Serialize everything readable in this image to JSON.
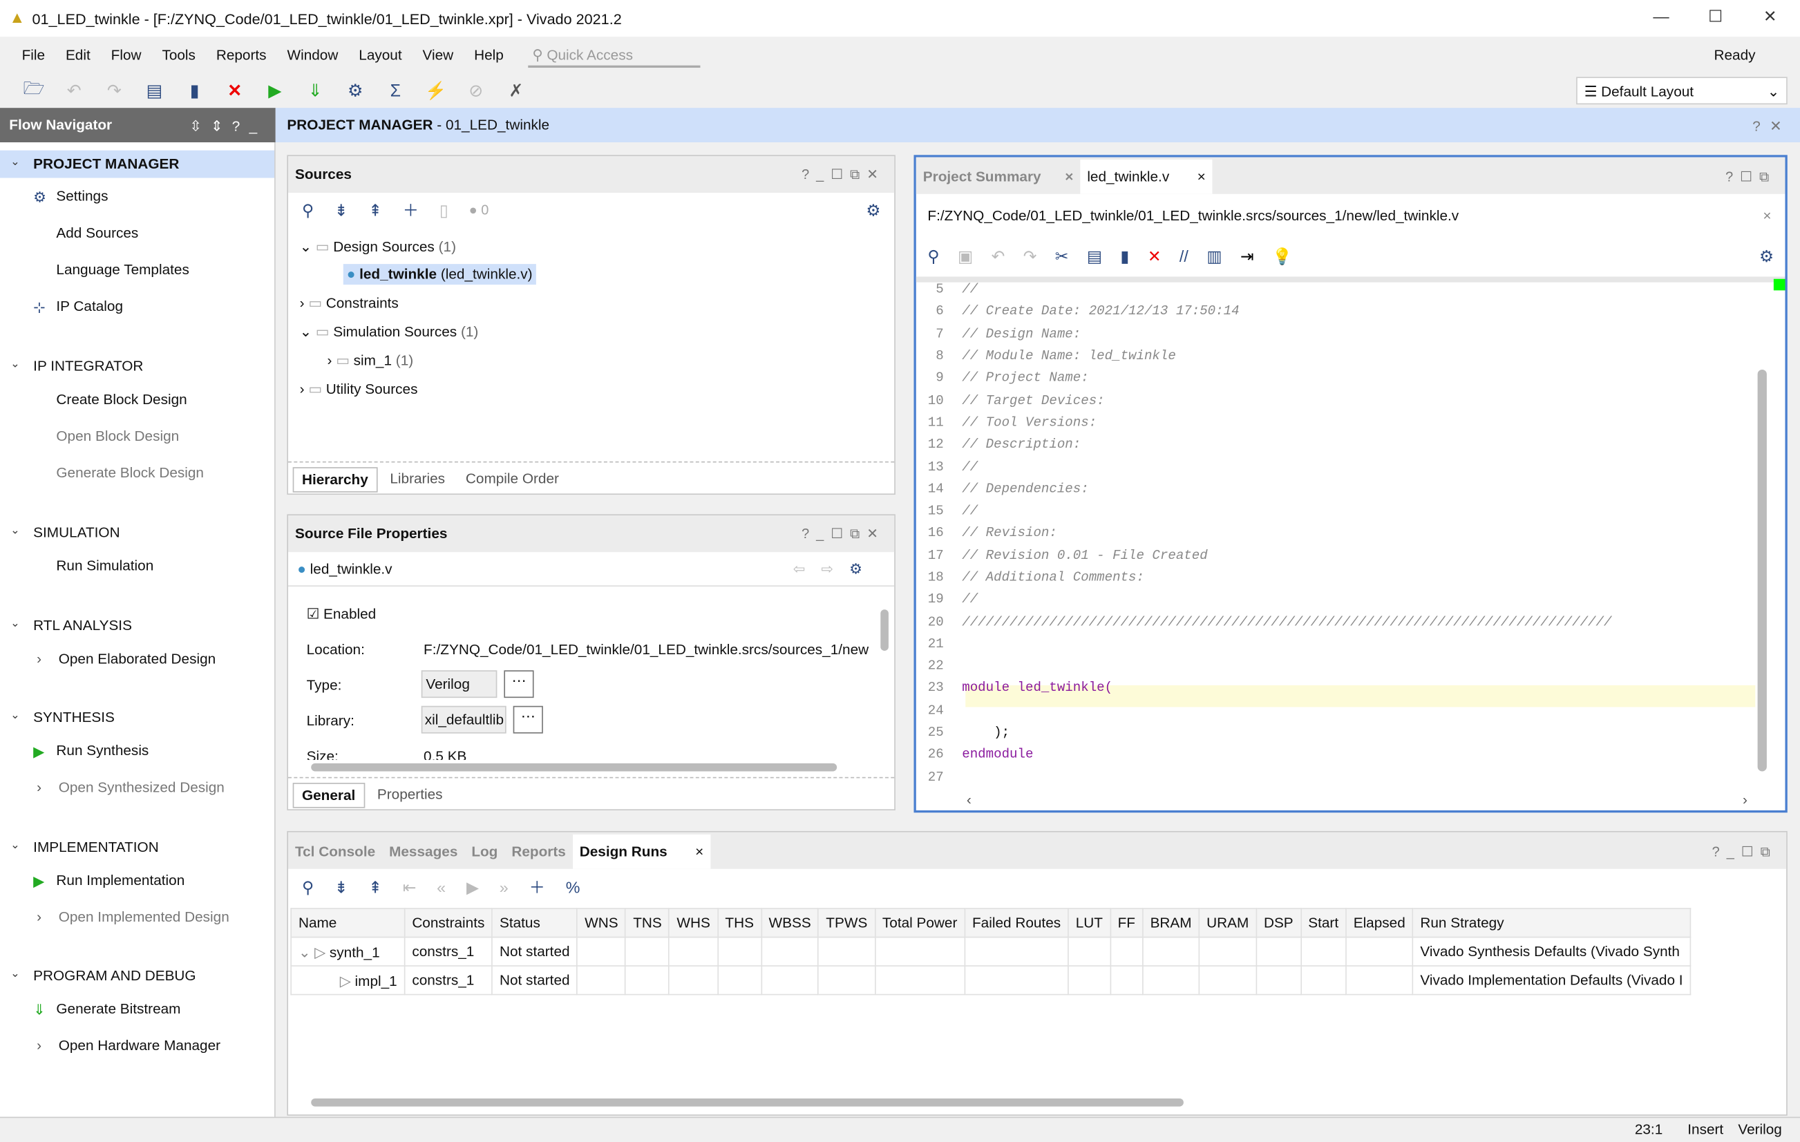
{
  "window": {
    "title": "01_LED_twinkle - [F:/ZYNQ_Code/01_LED_twinkle/01_LED_twinkle.xpr] - Vivado 2021.2",
    "status": "Ready"
  },
  "menu": [
    "File",
    "Edit",
    "Flow",
    "Tools",
    "Reports",
    "Window",
    "Layout",
    "View",
    "Help"
  ],
  "quick_access": {
    "placeholder": "Quick Access"
  },
  "layout_select": "Default Layout",
  "flow_navigator": {
    "title": "Flow Navigator",
    "sections": [
      {
        "label": "PROJECT MANAGER",
        "items": [
          "Settings",
          "Add Sources",
          "Language Templates",
          "IP Catalog"
        ]
      },
      {
        "label": "IP INTEGRATOR",
        "items": [
          "Create Block Design",
          "Open Block Design",
          "Generate Block Design"
        ]
      },
      {
        "label": "SIMULATION",
        "items": [
          "Run Simulation"
        ]
      },
      {
        "label": "RTL ANALYSIS",
        "items": [
          "Open Elaborated Design"
        ]
      },
      {
        "label": "SYNTHESIS",
        "items": [
          "Run Synthesis",
          "Open Synthesized Design"
        ]
      },
      {
        "label": "IMPLEMENTATION",
        "items": [
          "Run Implementation",
          "Open Implemented Design"
        ]
      },
      {
        "label": "PROGRAM AND DEBUG",
        "items": [
          "Generate Bitstream",
          "Open Hardware Manager"
        ]
      }
    ]
  },
  "header": {
    "bold": "PROJECT MANAGER",
    "rest": " - 01_LED_twinkle"
  },
  "sources": {
    "title": "Sources",
    "count": "0",
    "tree": {
      "design": "Design Sources",
      "design_count": "(1)",
      "top": "led_twinkle",
      "top_file": "(led_twinkle.v)",
      "constraints": "Constraints",
      "sim": "Simulation Sources",
      "sim_count": "(1)",
      "sim1": "sim_1",
      "sim1_count": "(1)",
      "utility": "Utility Sources"
    },
    "tabs": [
      "Hierarchy",
      "Libraries",
      "Compile Order"
    ]
  },
  "props": {
    "title": "Source File Properties",
    "file": "led_twinkle.v",
    "enabled": "Enabled",
    "location_label": "Location:",
    "location": "F:/ZYNQ_Code/01_LED_twinkle/01_LED_twinkle.srcs/sources_1/new",
    "type_label": "Type:",
    "type": "Verilog",
    "library_label": "Library:",
    "library": "xil_defaultlib",
    "size_label": "Size:",
    "size": "0.5 KB",
    "tabs": [
      "General",
      "Properties"
    ]
  },
  "editor": {
    "tabs": [
      "Project Summary",
      "led_twinkle.v"
    ],
    "path": "F:/ZYNQ_Code/01_LED_twinkle/01_LED_twinkle.srcs/sources_1/new/led_twinkle.v",
    "lines": [
      {
        "n": "5",
        "t": "//",
        "c": "cm"
      },
      {
        "n": "6",
        "t": "// Create Date: 2021/12/13 17:50:14",
        "c": "cm"
      },
      {
        "n": "7",
        "t": "// Design Name:",
        "c": "cm"
      },
      {
        "n": "8",
        "t": "// Module Name: led_twinkle",
        "c": "cm"
      },
      {
        "n": "9",
        "t": "// Project Name:",
        "c": "cm"
      },
      {
        "n": "10",
        "t": "// Target Devices:",
        "c": "cm"
      },
      {
        "n": "11",
        "t": "// Tool Versions:",
        "c": "cm"
      },
      {
        "n": "12",
        "t": "// Description:",
        "c": "cm"
      },
      {
        "n": "13",
        "t": "//",
        "c": "cm"
      },
      {
        "n": "14",
        "t": "// Dependencies:",
        "c": "cm"
      },
      {
        "n": "15",
        "t": "//",
        "c": "cm"
      },
      {
        "n": "16",
        "t": "// Revision:",
        "c": "cm"
      },
      {
        "n": "17",
        "t": "// Revision 0.01 - File Created",
        "c": "cm"
      },
      {
        "n": "18",
        "t": "// Additional Comments:",
        "c": "cm"
      },
      {
        "n": "19",
        "t": "//",
        "c": "cm"
      },
      {
        "n": "20",
        "t": "//////////////////////////////////////////////////////////////////////////////////",
        "c": "cm"
      },
      {
        "n": "21",
        "t": "",
        "c": ""
      },
      {
        "n": "22",
        "t": "",
        "c": ""
      },
      {
        "n": "23",
        "t": "module led_twinkle(",
        "c": "kw"
      },
      {
        "n": "24",
        "t": "",
        "c": ""
      },
      {
        "n": "25",
        "t": "    );",
        "c": ""
      },
      {
        "n": "26",
        "t": "endmodule",
        "c": "kw"
      },
      {
        "n": "27",
        "t": "",
        "c": ""
      }
    ]
  },
  "bottom": {
    "tabs": [
      "Tcl Console",
      "Messages",
      "Log",
      "Reports",
      "Design Runs"
    ],
    "columns": [
      "Name",
      "Constraints",
      "Status",
      "WNS",
      "TNS",
      "WHS",
      "THS",
      "WBSS",
      "TPWS",
      "Total Power",
      "Failed Routes",
      "LUT",
      "FF",
      "BRAM",
      "URAM",
      "DSP",
      "Start",
      "Elapsed",
      "Run Strategy"
    ],
    "rows": [
      [
        "synth_1",
        "constrs_1",
        "Not started",
        "",
        "",
        "",
        "",
        "",
        "",
        "",
        "",
        "",
        "",
        "",
        "",
        "",
        "",
        "",
        "Vivado Synthesis Defaults (Vivado Synth"
      ],
      [
        "impl_1",
        "constrs_1",
        "Not started",
        "",
        "",
        "",
        "",
        "",
        "",
        "",
        "",
        "",
        "",
        "",
        "",
        "",
        "",
        "",
        "Vivado Implementation Defaults (Vivado I"
      ]
    ]
  },
  "statusbar": {
    "pos": "23:1",
    "mode": "Insert",
    "lang": "Verilog"
  }
}
